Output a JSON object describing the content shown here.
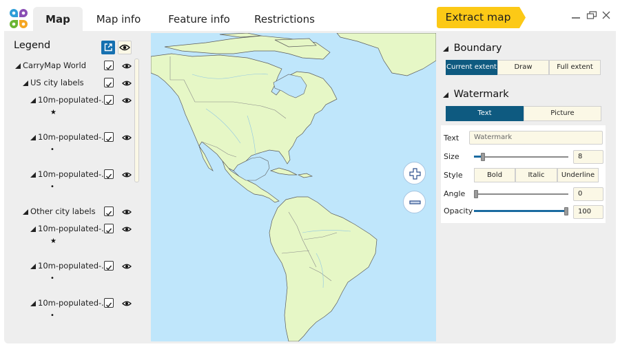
{
  "window": {
    "tabs": [
      {
        "label": "Map",
        "active": true
      },
      {
        "label": "Map info",
        "active": false
      },
      {
        "label": "Feature info",
        "active": false
      },
      {
        "label": "Restrictions",
        "active": false
      }
    ],
    "extract_button": "Extract map",
    "controls": {
      "minimize": "minimize-icon",
      "restore": "restore-icon",
      "close": "close-icon"
    }
  },
  "legend": {
    "title": "Legend",
    "layers": [
      {
        "label": "CarryMap World",
        "checked": true,
        "visible": true
      },
      {
        "label": "US city labels",
        "checked": true,
        "visible": true
      },
      {
        "label": "10m-populated-...",
        "checked": true,
        "visible": true,
        "symbol": "★"
      },
      {
        "label": "10m-populated-...",
        "checked": true,
        "visible": true,
        "symbol": "•"
      },
      {
        "label": "10m-populated-...",
        "checked": true,
        "visible": true,
        "symbol": "•"
      },
      {
        "label": "Other city labels",
        "checked": true,
        "visible": true
      },
      {
        "label": "10m-populated-...",
        "checked": true,
        "visible": true,
        "symbol": "★"
      },
      {
        "label": "10m-populated-...",
        "checked": true,
        "visible": true,
        "symbol": "•"
      },
      {
        "label": "10m-populated-...",
        "checked": true,
        "visible": true,
        "symbol": "•"
      }
    ]
  },
  "map": {
    "zoom_in": "+",
    "zoom_out": "−",
    "region": "North and South America"
  },
  "boundary": {
    "title": "Boundary",
    "options": [
      "Current extent",
      "Draw",
      "Full extent"
    ],
    "selected": "Current extent"
  },
  "watermark": {
    "title": "Watermark",
    "types": [
      "Text",
      "Picture"
    ],
    "selected_type": "Text",
    "text_label": "Text",
    "text_placeholder": "Watermark",
    "size_label": "Size",
    "size_value": "8",
    "size_slider_fraction": 0.08,
    "style_label": "Style",
    "style_options": [
      "Bold",
      "Italic",
      "Underline"
    ],
    "angle_label": "Angle",
    "angle_value": "0",
    "angle_slider_fraction": 0.0,
    "opacity_label": "Opacity",
    "opacity_value": "100",
    "opacity_slider_fraction": 1.0
  },
  "colors": {
    "accent": "#0e5a80",
    "extract": "#fcc916",
    "water": "#bfe6fb",
    "land": "#e6f7c6",
    "panel_bg": "#eeeeee",
    "button_bg": "#fbf8e6"
  }
}
